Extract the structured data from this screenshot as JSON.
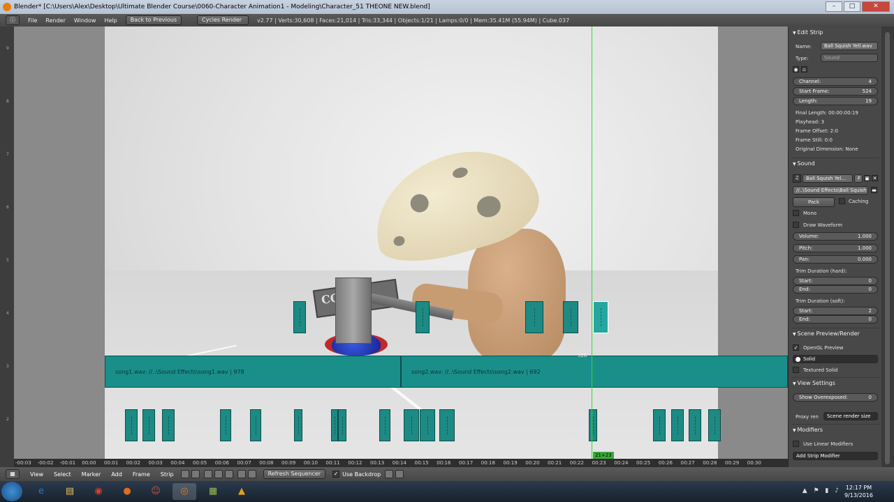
{
  "window": {
    "title": "Blender* [C:\\Users\\Alex\\Desktop\\Ultimate Blender Course\\0060-Character Animation1 - Modeling\\Character_51 THEONE NEW.blend]",
    "controls": [
      "–",
      "□",
      "✕"
    ]
  },
  "infobar": {
    "menus": [
      "File",
      "Render",
      "Window",
      "Help"
    ],
    "back_button": "Back to Previous",
    "render_engine": "Cycles Render",
    "stats": "v2.77 | Verts:30,608 | Faces:21,014 | Tris:33,344 | Objects:1/21 | Lamps:0/0 | Mem:35.41M (55.94M) | Cube.037"
  },
  "viewport": {
    "sign_text": "CON",
    "side_ticks": [
      "9",
      "8",
      "7",
      "6",
      "5",
      "4",
      "3",
      "2"
    ],
    "big_strips": [
      {
        "label": "song1.wav: //..\\Sound Effects\\song1.wav | 978"
      },
      {
        "label": "song2.wav: //..\\Sound Effects\\song2.wav | 692"
      }
    ],
    "playhead_label": "526",
    "cursor_frame": "21+23"
  },
  "timeline": {
    "ticks": [
      "-00:03",
      "-00:02",
      "-00:01",
      "00:00",
      "00:01",
      "00:02",
      "00:03",
      "00:04",
      "00:05",
      "00:06",
      "00:07",
      "00:08",
      "00:09",
      "00:10",
      "00:11",
      "00:12",
      "00:13",
      "00:14",
      "00:15",
      "00:16",
      "00:17",
      "00:18",
      "00:19",
      "00:20",
      "00:21",
      "00:22",
      "00:23",
      "00:24",
      "00:25",
      "00:26",
      "00:27",
      "00:28",
      "00:29",
      "00:30"
    ]
  },
  "bottombar": {
    "menus": [
      "View",
      "Select",
      "Marker",
      "Add",
      "Frame",
      "Strip"
    ],
    "refresh_button": "Refresh Sequencer",
    "use_backdrop_label": "Use Backdrop",
    "use_backdrop_checked": true
  },
  "properties": {
    "edit_strip": {
      "header": "Edit Strip",
      "name_label": "Name:",
      "name_value": "Ball Squish Yell.wav",
      "type_label": "Type:",
      "type_value": "Sound",
      "channel_label": "Channel:",
      "channel_value": "4",
      "start_label": "Start Frame:",
      "start_value": "524",
      "length_label": "Length:",
      "length_value": "19",
      "info": [
        "Final Length: 00:00:00:19",
        "Playhead: 3",
        "Frame Offset: 2:0",
        "Frame Still: 0:0",
        "Original Dimension: None"
      ]
    },
    "sound": {
      "header": "Sound",
      "datablock": "Ball Squish Yel...",
      "fake_user": "F",
      "filepath": "//..\\Sound Effects\\Ball Squish ...",
      "pack_button": "Pack",
      "caching_label": "Caching",
      "mono_label": "Mono",
      "waveform_label": "Draw Waveform",
      "volume_label": "Volume:",
      "volume_value": "1.000",
      "pitch_label": "Pitch:",
      "pitch_value": "1.000",
      "pan_label": "Pan:",
      "pan_value": "0.000",
      "trim_hard_label": "Trim Duration (hard):",
      "hard_start_label": "Start:",
      "hard_start_value": "0",
      "hard_end_label": "End:",
      "hard_end_value": "0",
      "trim_soft_label": "Trim Duration (soft):",
      "soft_start_label": "Start:",
      "soft_start_value": "2",
      "soft_end_label": "End:",
      "soft_end_value": "0"
    },
    "scene_preview": {
      "header": "Scene Preview/Render",
      "opengl_label": "OpenGL Preview",
      "opengl_checked": true,
      "shading_value": "Solid",
      "textured_label": "Textured Solid"
    },
    "view_settings": {
      "header": "View Settings",
      "overexposed_label": "Show Overexposed:",
      "overexposed_value": "0",
      "proxy_label": "Proxy ren",
      "proxy_value": "Scene render size"
    },
    "modifiers": {
      "header": "Modifiers",
      "linear_label": "Use Linear Modifiers",
      "add_button": "Add Strip Modifier"
    }
  },
  "taskbar": {
    "apps": [
      {
        "icon": "ie-icon",
        "glyph": "e",
        "color": "#1f78d1"
      },
      {
        "icon": "explorer-icon",
        "glyph": "▤",
        "color": "#e6c15a"
      },
      {
        "icon": "chrome-icon",
        "glyph": "◉",
        "color": "#d9412f"
      },
      {
        "icon": "firefox-icon",
        "glyph": "●",
        "color": "#e36c1a"
      },
      {
        "icon": "user-app-icon",
        "glyph": "☺",
        "color": "#c9563c"
      },
      {
        "icon": "blender-icon",
        "glyph": "◎",
        "color": "#e87d0d"
      },
      {
        "icon": "notes-icon",
        "glyph": "▦",
        "color": "#9bbd4a"
      },
      {
        "icon": "lock-app-icon",
        "glyph": "▲",
        "color": "#e0a21a"
      }
    ],
    "time": "12:17 PM",
    "date": "9/13/2016",
    "tray": "▲ ⚑ ▮ ♪"
  }
}
